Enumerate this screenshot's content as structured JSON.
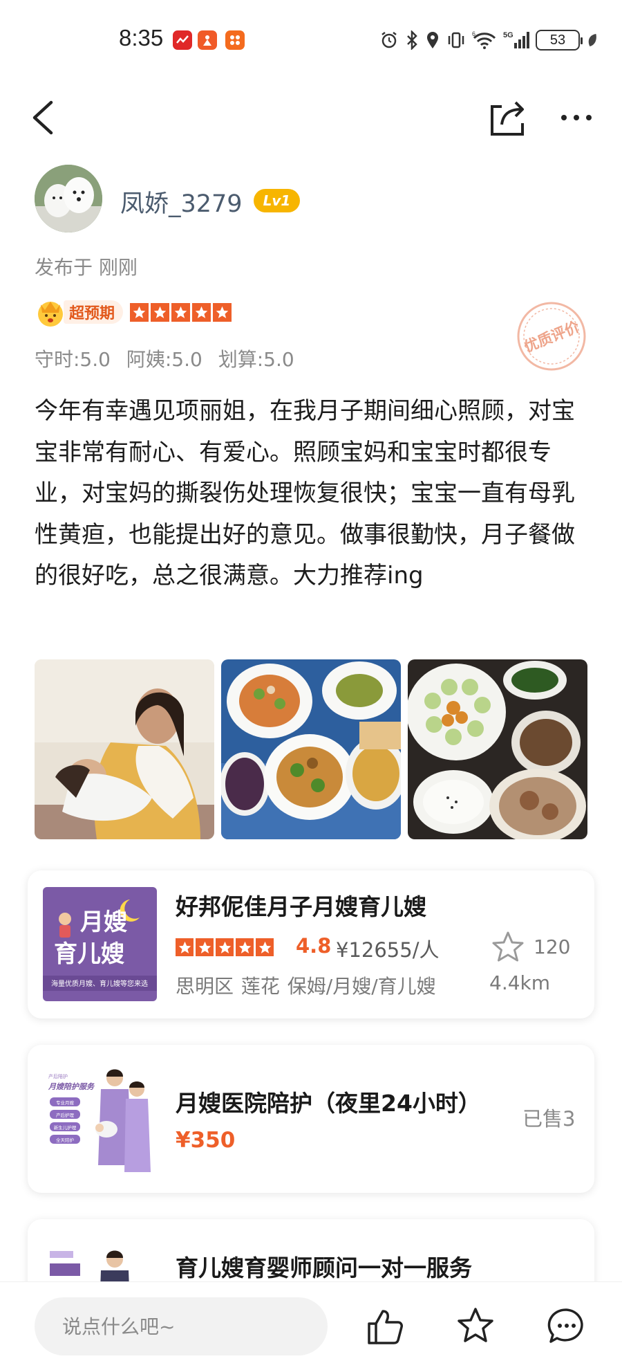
{
  "status_bar": {
    "time": "8:35",
    "network": "5G",
    "battery": "53",
    "icons": [
      "alarm-icon",
      "bluetooth-icon",
      "location-icon",
      "vibrate-icon",
      "wifi-icon",
      "signal-icon"
    ]
  },
  "nav": {
    "icons": [
      "back-icon",
      "share-icon",
      "more-icon"
    ]
  },
  "review": {
    "username": "凤娇_3279",
    "level": "Lv1",
    "publish_time": "发布于 刚刚",
    "badge": "超预期",
    "stars": 5,
    "scores": "守时:5.0 阿姨:5.0 划算:5.0",
    "stamp": "优质评价",
    "text": "今年有幸遇见项丽姐，在我月子期间细心照顾，对宝宝非常有耐心、有爱心。照顾宝妈和宝宝时都很专业，对宝妈的撕裂伤处理恢复很快；宝宝一直有母乳性黄疸，也能提出好的意见。做事很勤快，月子餐做的很好吃，总之很满意。大力推荐ing"
  },
  "shop_card": {
    "title": "好邦伲佳月子月嫂育儿嫂",
    "thumb_line1": "月嫂",
    "thumb_line2": "育儿嫂",
    "thumb_footer": "海量优质月嫂、育儿嫂等您来选",
    "stars": 5,
    "rating": "4.8",
    "price": "¥12655/人",
    "favorites": "120",
    "meta": "思明区 莲花 保姆/月嫂/育儿嫂",
    "distance": "4.4km"
  },
  "service_card": {
    "title": "月嫂医院陪护（夜里24小时）",
    "thumb_title": "月嫂陪护服务",
    "thumb_items": [
      "专业月嫂",
      "产后护理",
      "新生儿护理",
      "全天陪护"
    ],
    "price": "¥350",
    "sold": "已售3"
  },
  "service_card_2": {
    "title": "育儿嫂育婴师顾问一对一服务"
  },
  "bottom_bar": {
    "comment_placeholder": "说点什么吧~",
    "icons": [
      "like-icon",
      "favorite-icon",
      "comment-icon"
    ]
  },
  "colors": {
    "accent": "#ee5f29",
    "level_badge": "#f7b500",
    "username": "#4b5b6e",
    "thumb_purple": "#7b5aa6"
  }
}
